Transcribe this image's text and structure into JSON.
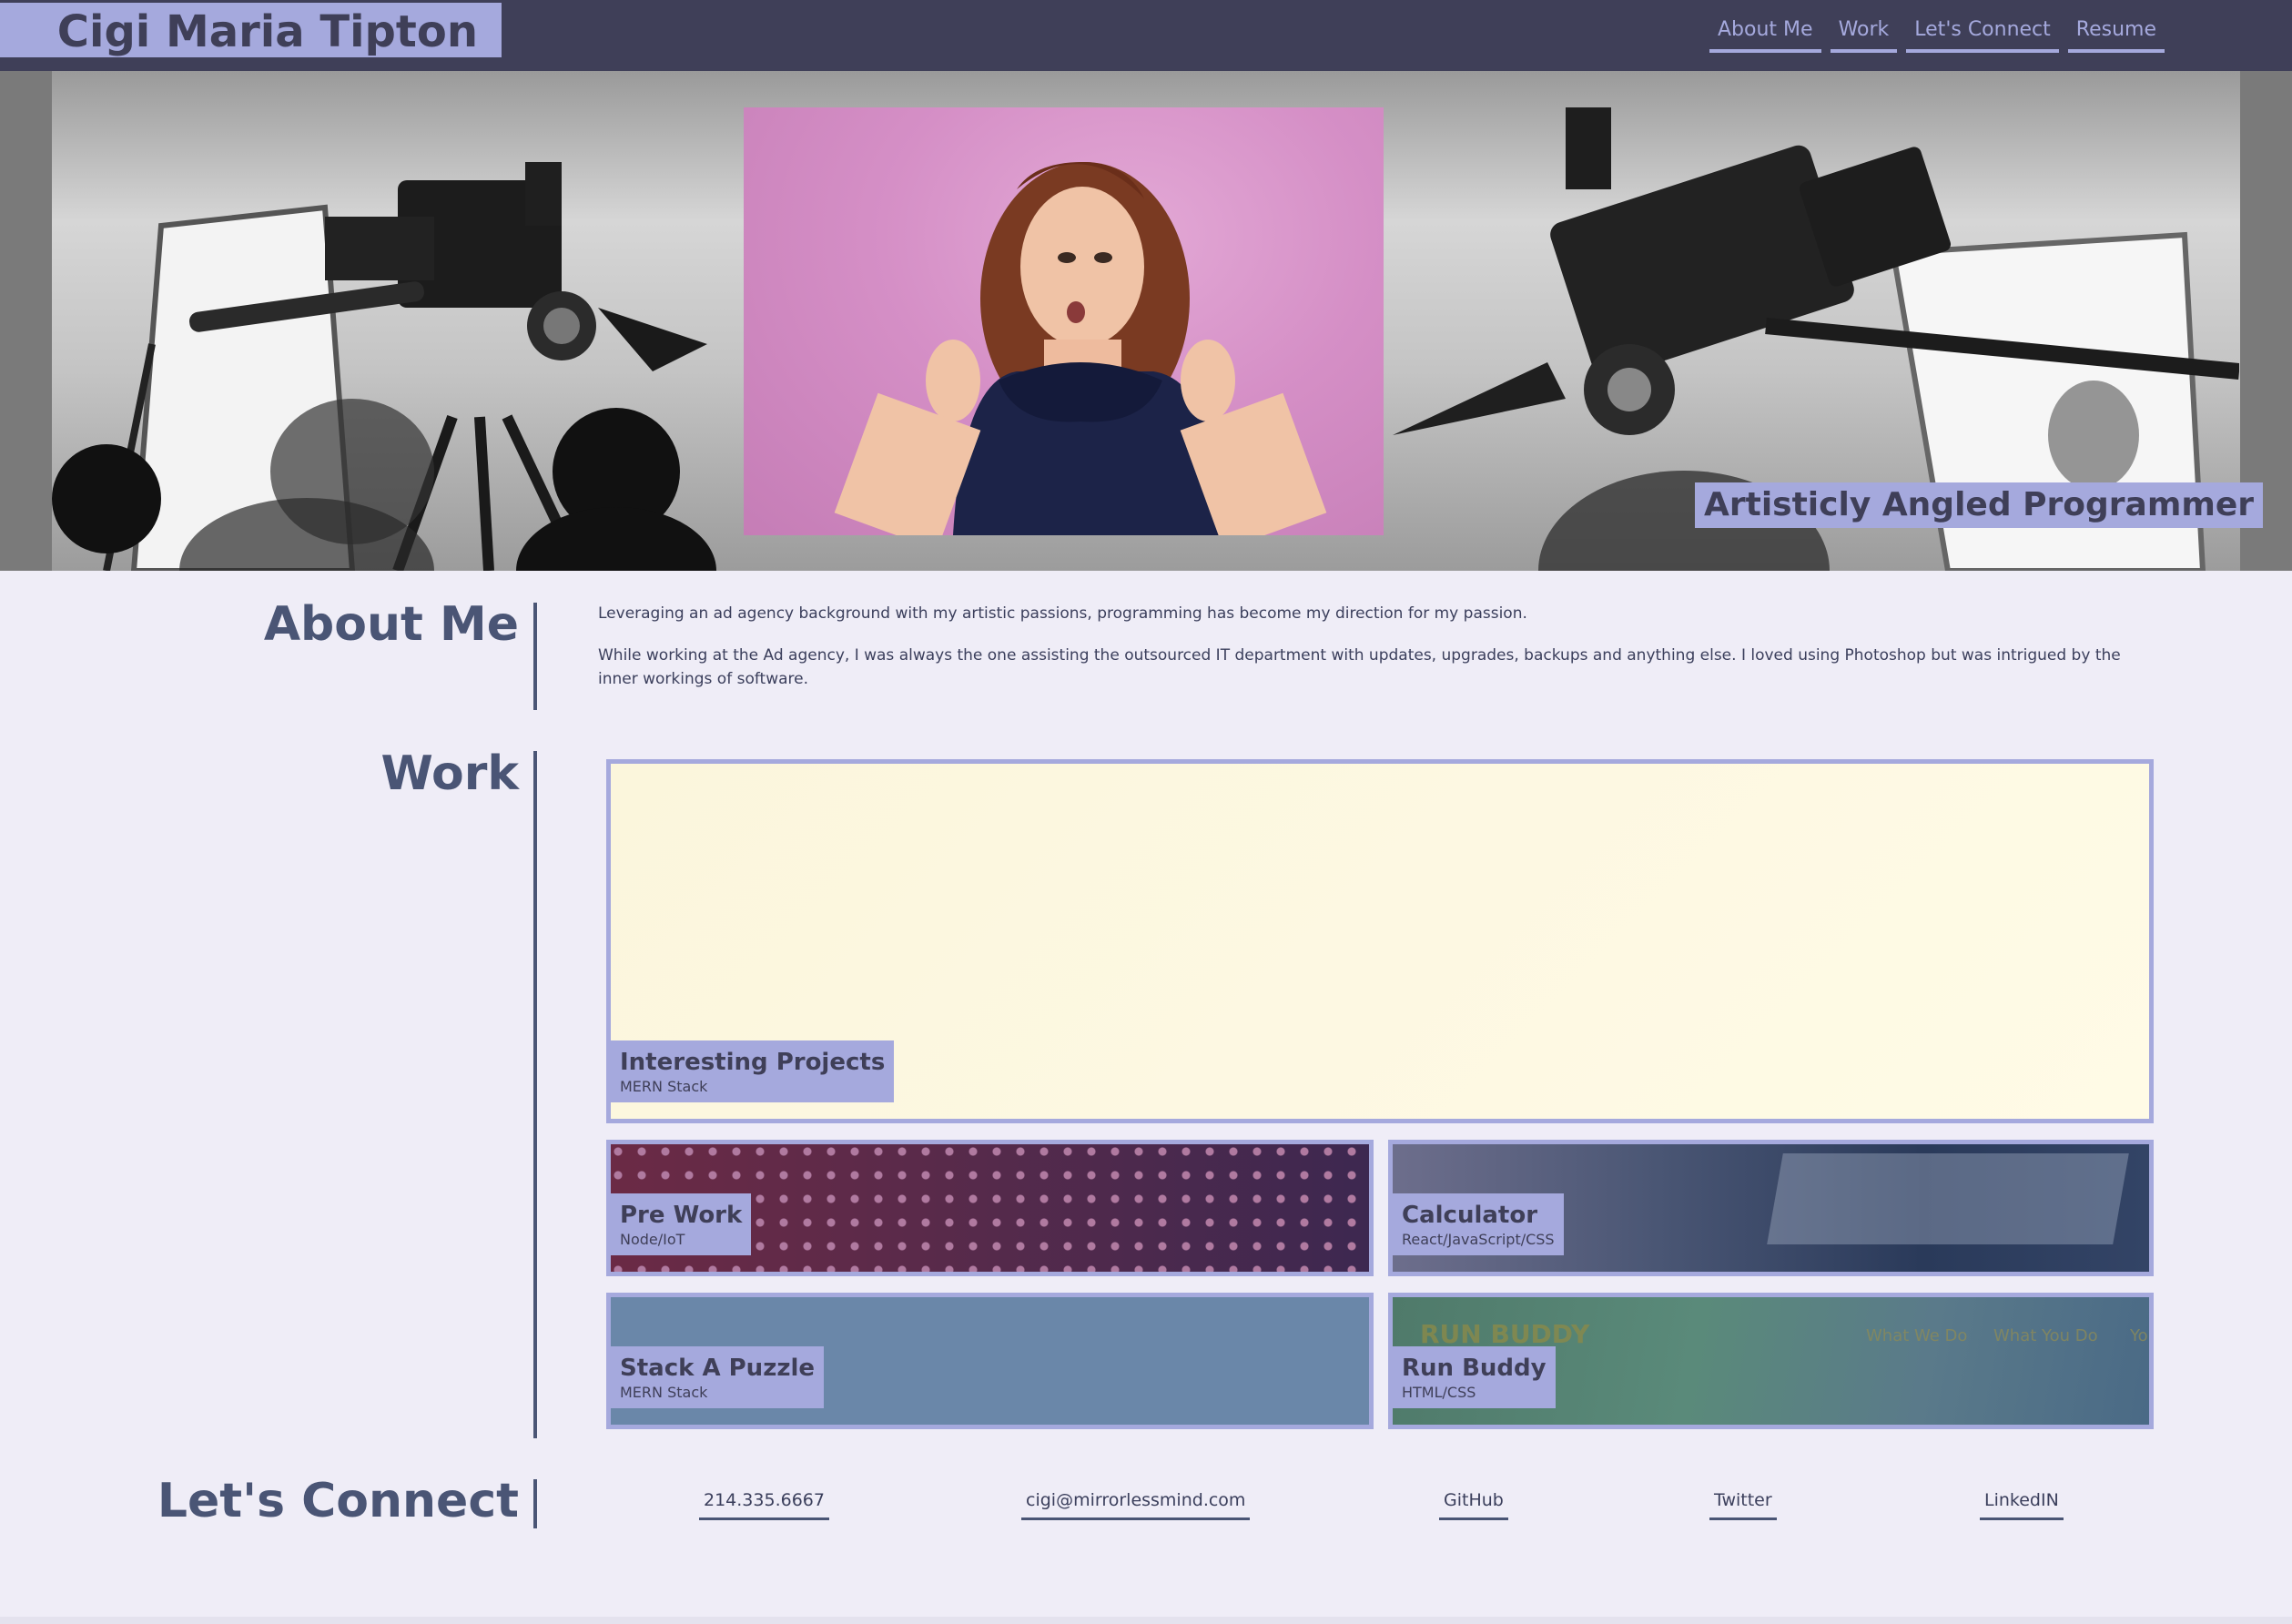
{
  "header": {
    "name": "Cigi Maria Tipton",
    "nav": [
      "About Me",
      "Work",
      "Let's Connect",
      "Resume"
    ]
  },
  "hero": {
    "tagline": "Artisticly Angled Programmer",
    "portrait_alt": "portrait photo"
  },
  "about": {
    "title": "About Me",
    "p1": "Leveraging an ad agency background with my artistic passions, programming has become my direction for my passion.",
    "p2": "While working at the Ad agency, I was always the one assisting the outsourced IT department with updates, upgrades, backups and anything else. I loved using Photoshop but was intrigued by the inner workings of software."
  },
  "work": {
    "title": "Work",
    "projects": [
      {
        "title": "Interesting Projects",
        "stack": "MERN Stack"
      },
      {
        "title": "Pre Work",
        "stack": "Node/IoT"
      },
      {
        "title": "Calculator",
        "stack": "React/JavaScript/CSS"
      },
      {
        "title": "Stack A Puzzle",
        "stack": "MERN Stack"
      },
      {
        "title": "Run Buddy",
        "stack": "HTML/CSS",
        "screenshot_text": [
          "RUN BUDDY",
          "What We Do",
          "What You Do",
          "Yo"
        ]
      }
    ]
  },
  "connect": {
    "title": "Let's Connect",
    "links": [
      "214.335.6667",
      "cigi@mirrorlessmind.com",
      "GitHub",
      "Twitter",
      "LinkedIN"
    ]
  },
  "colors": {
    "header_bg": "#3f3f58",
    "accent": "#a5a9dd",
    "heading": "#4a5575",
    "page_bg": "#efedf7"
  }
}
